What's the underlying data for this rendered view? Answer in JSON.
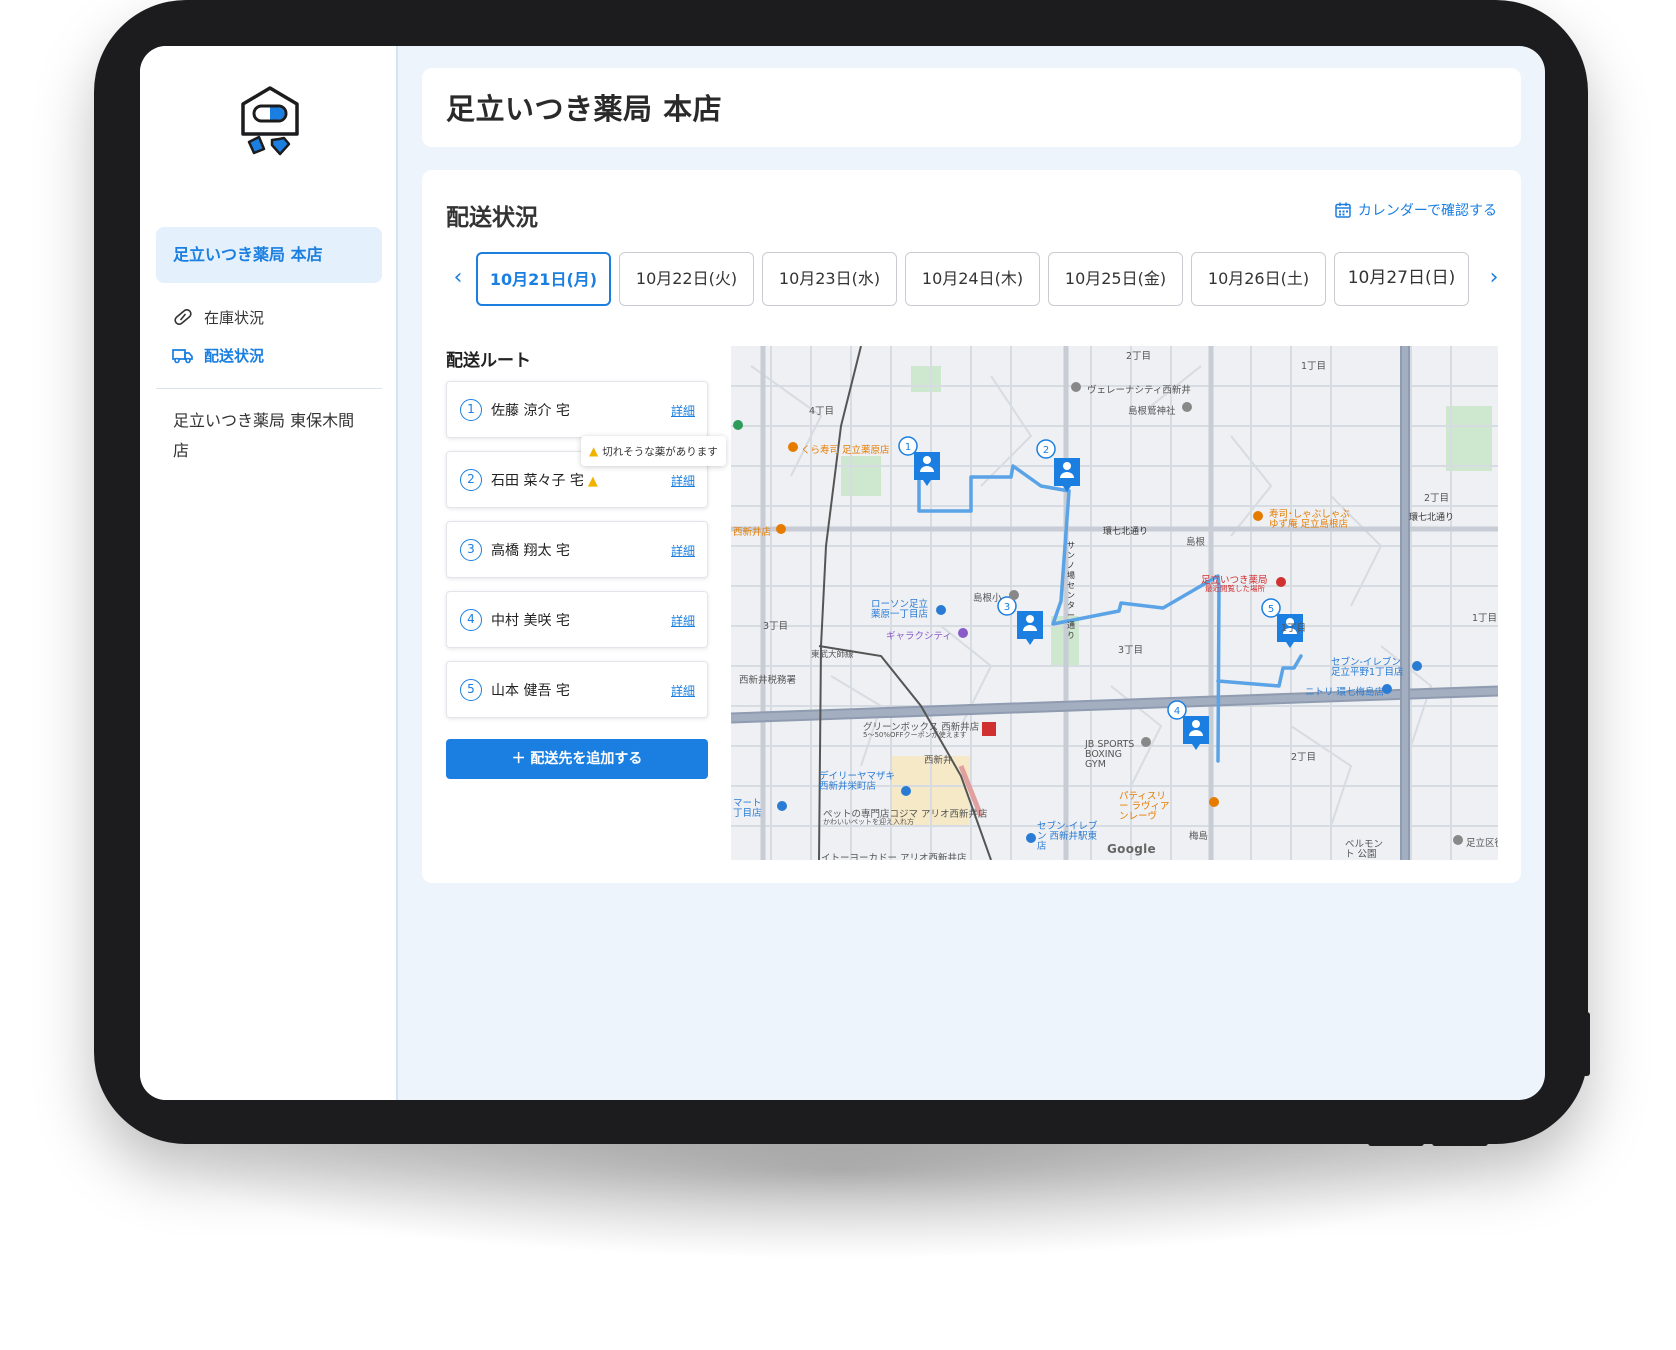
{
  "app": {
    "title": "足立いつき薬局 本店",
    "accent_color": "#1a7fe0"
  },
  "sidebar": {
    "logo_icon": "pharmacy-box-logo",
    "stores": [
      {
        "label": "足立いつき薬局 本店",
        "active": true
      },
      {
        "label": "足立いつき薬局 東保木間店",
        "active": false
      }
    ],
    "sub_items": [
      {
        "label": "在庫状況",
        "icon": "pill-icon",
        "active": false
      },
      {
        "label": "配送状況",
        "icon": "truck-icon",
        "active": true
      }
    ]
  },
  "delivery": {
    "section_title": "配送状況",
    "calendar_link": "カレンダーで確認する",
    "dates": [
      {
        "label": "10月21日(月)",
        "active": true
      },
      {
        "label": "10月22日(火)",
        "active": false
      },
      {
        "label": "10月23日(水)",
        "active": false
      },
      {
        "label": "10月24日(木)",
        "active": false
      },
      {
        "label": "10月25日(金)",
        "active": false
      },
      {
        "label": "10月26日(土)",
        "active": false
      },
      {
        "label": "10月27日(日)",
        "active": false
      }
    ],
    "route_title": "配送ルート",
    "stops": [
      {
        "num": "1",
        "name": "佐藤 涼介 宅",
        "warning": false,
        "detail": "詳細"
      },
      {
        "num": "2",
        "name": "石田 菜々子 宅",
        "warning": true,
        "detail": "詳細"
      },
      {
        "num": "3",
        "name": "高橋 翔太 宅",
        "warning": false,
        "detail": "詳細"
      },
      {
        "num": "4",
        "name": "中村 美咲 宅",
        "warning": false,
        "detail": "詳細"
      },
      {
        "num": "5",
        "name": "山本 健吾 宅",
        "warning": false,
        "detail": "詳細"
      }
    ],
    "warning_tooltip": "切れそうな薬があります",
    "add_button": "＋ 配送先を追加する"
  },
  "map": {
    "labels": {
      "cho2_top": "2丁目",
      "cho1_top": "1丁目",
      "cho4": "4丁目",
      "verena": "ヴェレーナシティ西新井",
      "shrine": "島根鷲神社",
      "kura": "くら寿司 足立薬原店",
      "nishiaraiten": "西新井店",
      "kannana": "環七北通り",
      "kannana2": "環七北通り",
      "shimane": "島根",
      "sushi": "寿司･しゃぶしゃぶ ゆず庵 足立島根店",
      "pharmacy": "足立いつき薬局",
      "pharmacy_sub": "最近閲覧した場所",
      "lawson": "ローソン足立 薬原一丁目店",
      "galaxy": "ギャラクシティ",
      "shimane_sho": "島根小",
      "tobu": "東武大師線",
      "zeimusho": "西新井税務署",
      "cho3_left": "3丁目",
      "cho3_mid": "3丁目",
      "cho2_right": "2丁目",
      "cho1_right": "1丁目",
      "seven_heiya": "セブン-イレブン 足立平野1丁目店",
      "nitori": "ニトリ 環七梅島店",
      "greenbox": "グリーンボックス 西新井店",
      "coupon": "5〜50%OFFクーポンが使えます",
      "nishiarai_station": "西新井",
      "jbsports": "JB SPORTS BOXING GYM",
      "cho2_bottom": "2丁目",
      "daily": "デイリーヤマザキ 西新井栄町店",
      "kojima": "ペットの専門店コジマ アリオ西新井店",
      "kojima_sub": "かわいいペットを迎え入れ方",
      "seven_eki": "セブン-イレブン 西新井駅東店",
      "patisserie": "パティスリー ラヴィアンレーヴ",
      "umejima": "梅島",
      "belmont": "ベルモント 公園",
      "adachi_ku": "足立区役",
      "itoyokado": "イトーヨーカドー アリオ西新井店",
      "mart": "マート 丁目店",
      "center": "サンノ場センター通り",
      "cho1_mid": "1丁目",
      "google": "Google"
    },
    "route_color": "#5aa3e6",
    "pin_color": "#1a7fe0"
  }
}
